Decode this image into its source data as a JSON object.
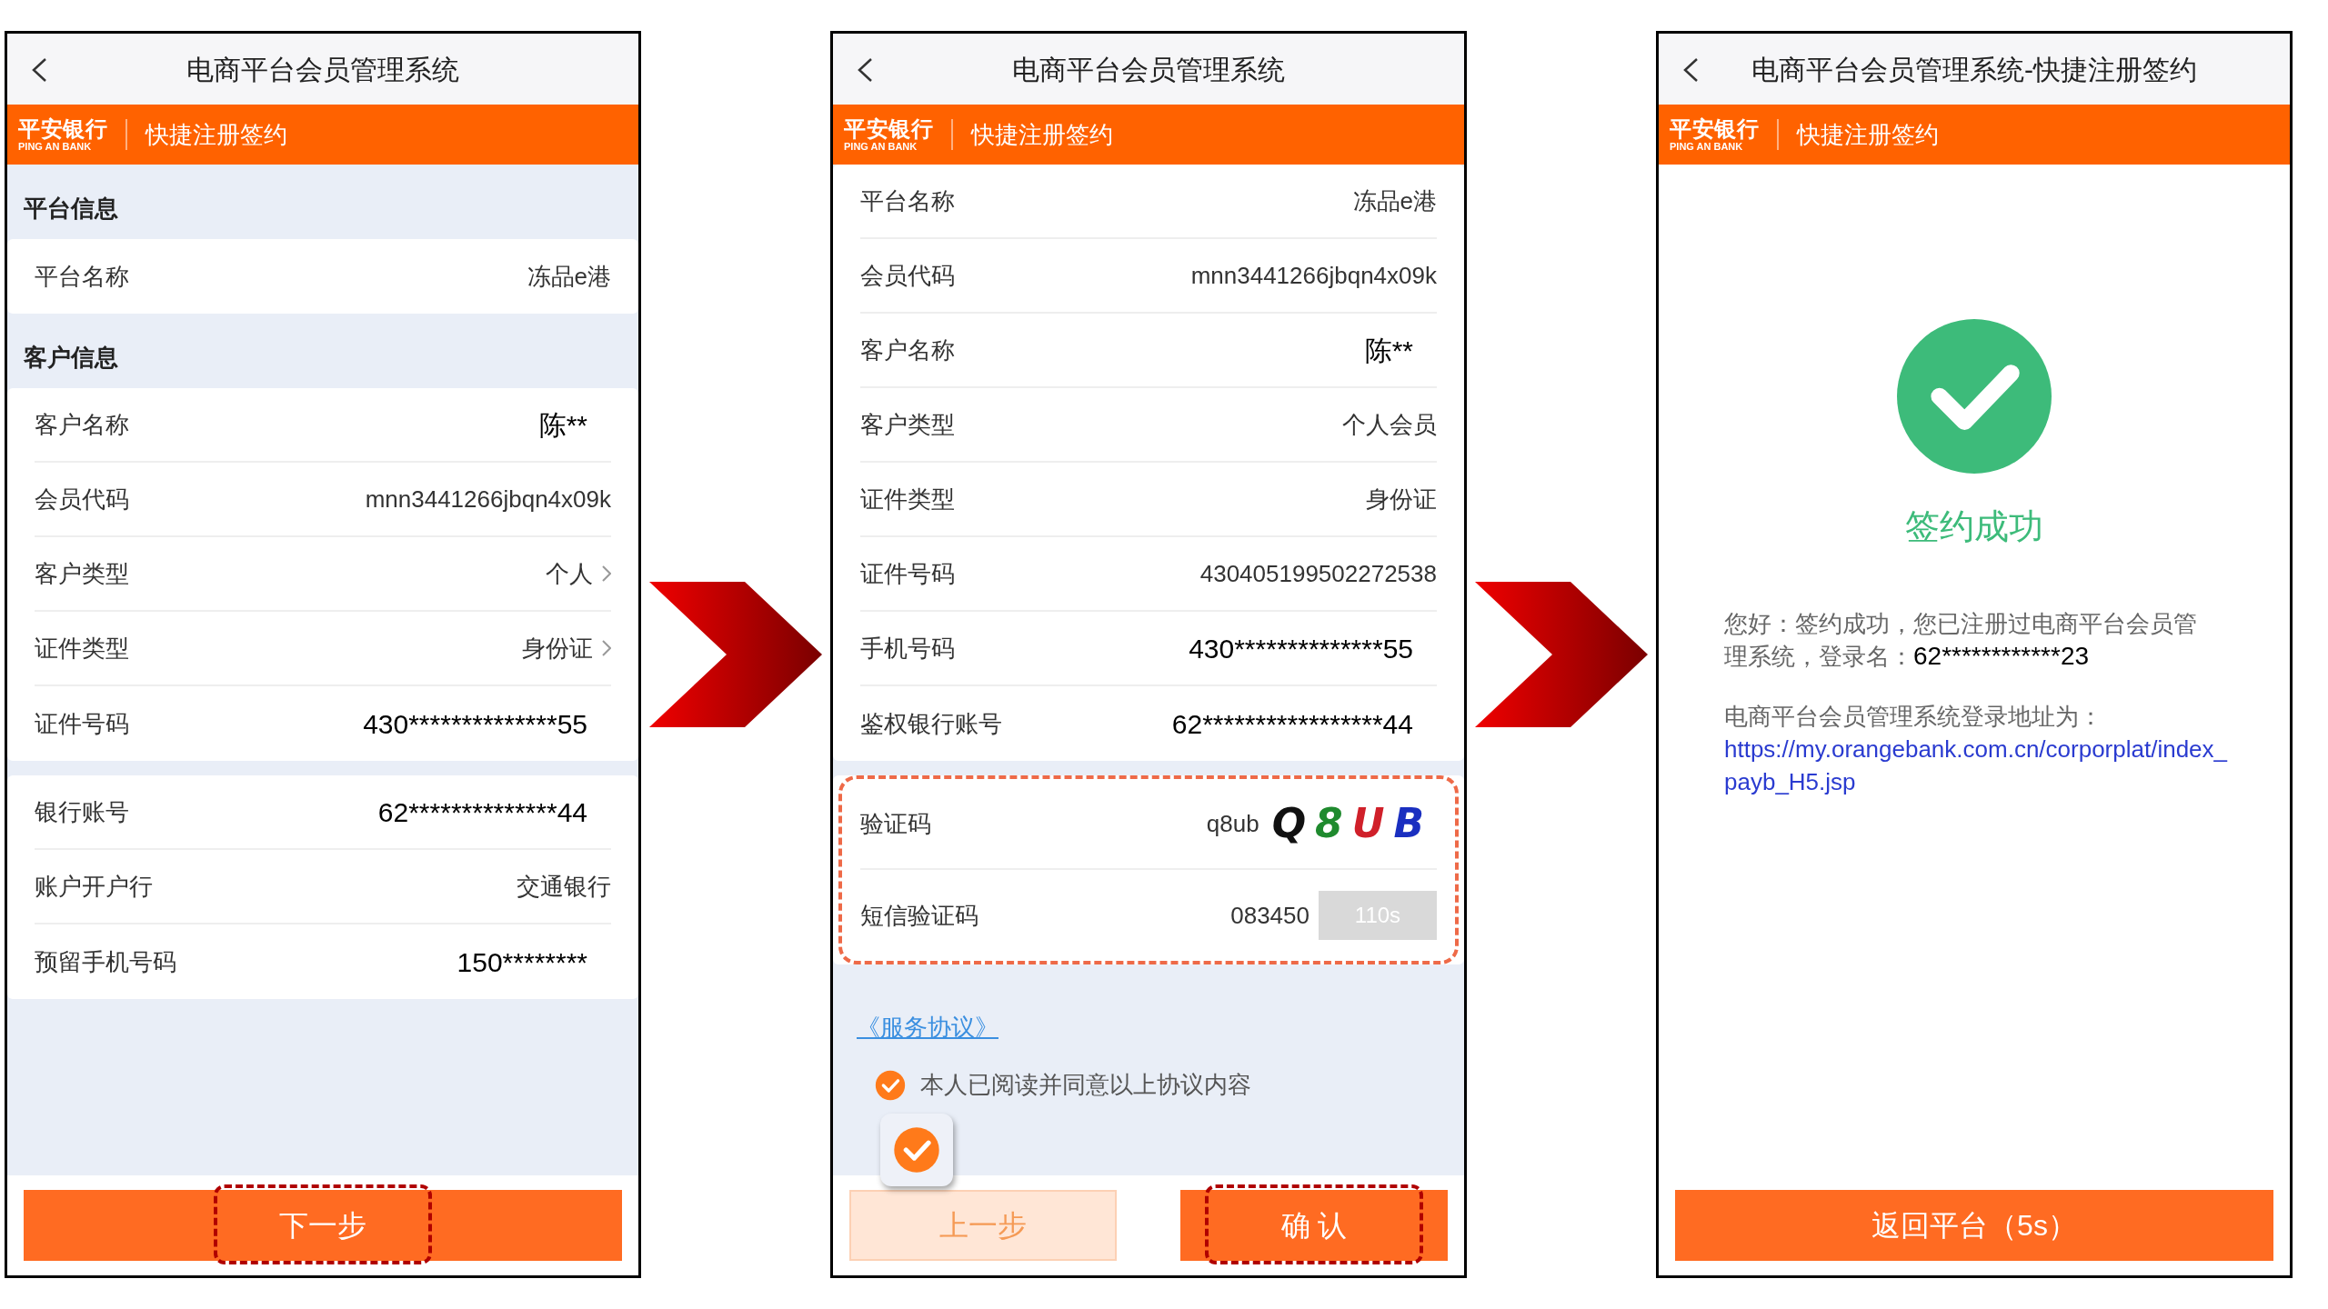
{
  "screens": [
    {
      "kind": "form",
      "title": "电商平台会员管理系统",
      "bank_logo": {
        "cn": "平安银行",
        "en": "PING AN BANK"
      },
      "banner": "快捷注册签约",
      "sections": [
        {
          "heading": "平台信息",
          "highlighted": false,
          "rows": [
            {
              "label": "平台名称",
              "value": "冻品e港",
              "kind": "text"
            }
          ]
        },
        {
          "heading": "客户信息",
          "highlighted": false,
          "rows": [
            {
              "label": "客户名称",
              "value": "陈**",
              "kind": "masked"
            },
            {
              "label": "会员代码",
              "value": "mnn3441266jbqn4x09k",
              "kind": "text"
            },
            {
              "label": "客户类型",
              "value": "个人",
              "kind": "select"
            },
            {
              "label": "证件类型",
              "value": "身份证",
              "kind": "select"
            },
            {
              "label": "证件号码",
              "value": "430**************55",
              "kind": "masked"
            }
          ]
        },
        {
          "highlighted": false,
          "rows": [
            {
              "label": "银行账号",
              "value": "62**************44",
              "kind": "masked"
            },
            {
              "label": "账户开户行",
              "value": "交通银行",
              "kind": "text"
            },
            {
              "label": "预留手机号码",
              "value": "150********",
              "kind": "masked"
            }
          ]
        }
      ],
      "buttons": [
        {
          "label": "下一步",
          "kind": "primary",
          "highlighted": true
        }
      ]
    },
    {
      "kind": "form",
      "title": "电商平台会员管理系统",
      "bank_logo": {
        "cn": "平安银行",
        "en": "PING AN BANK"
      },
      "banner": "快捷注册签约",
      "sections": [
        {
          "highlighted": false,
          "rows": [
            {
              "label": "平台名称",
              "value": "冻品e港",
              "kind": "text"
            },
            {
              "label": "会员代码",
              "value": "mnn3441266jbqn4x09k",
              "kind": "text"
            },
            {
              "label": "客户名称",
              "value": "陈**",
              "kind": "masked"
            },
            {
              "label": "客户类型",
              "value": "个人会员",
              "kind": "text"
            },
            {
              "label": "证件类型",
              "value": "身份证",
              "kind": "text"
            },
            {
              "label": "证件号码",
              "value": "430405199502272538",
              "kind": "text"
            },
            {
              "label": "手机号码",
              "value": "430**************55",
              "kind": "masked"
            },
            {
              "label": "鉴权银行账号",
              "value": "62*****************44",
              "kind": "masked"
            }
          ]
        },
        {
          "highlighted": true,
          "rows": [
            {
              "label": "验证码",
              "value": "q8ub",
              "kind": "captcha",
              "captcha": [
                {
                  "char": "Q",
                  "color": "#111111"
                },
                {
                  "char": "8",
                  "color": "#1f8a2e"
                },
                {
                  "char": "U",
                  "color": "#d0202a"
                },
                {
                  "char": "B",
                  "color": "#1a2fc0"
                }
              ]
            },
            {
              "label": "短信验证码",
              "value": "083450",
              "kind": "sms",
              "countdown": "110s"
            }
          ]
        }
      ],
      "agreement": {
        "link": "《服务协议》",
        "text": "本人已阅读并同意以上协议内容",
        "checked": true,
        "callout": true
      },
      "buttons": [
        {
          "label": "上一步",
          "kind": "secondary",
          "highlighted": false
        },
        {
          "label": "确 认",
          "kind": "primary",
          "highlighted": true
        }
      ]
    },
    {
      "kind": "result",
      "title": "电商平台会员管理系统-快捷注册签约",
      "bank_logo": {
        "cn": "平安银行",
        "en": "PING AN BANK"
      },
      "banner": "快捷注册签约",
      "status": "签约成功",
      "message": "您好：签约成功，您已注册过电商平台会员管理系统，登录名：",
      "login_name": "62************23",
      "address_label": "电商平台会员管理系统登录地址为：",
      "url": "https://my.orangebank.com.cn/corporplat/index_payb_H5.jsp",
      "buttons": [
        {
          "label": "返回平台（5s）",
          "kind": "primary",
          "highlighted": false
        }
      ]
    }
  ]
}
